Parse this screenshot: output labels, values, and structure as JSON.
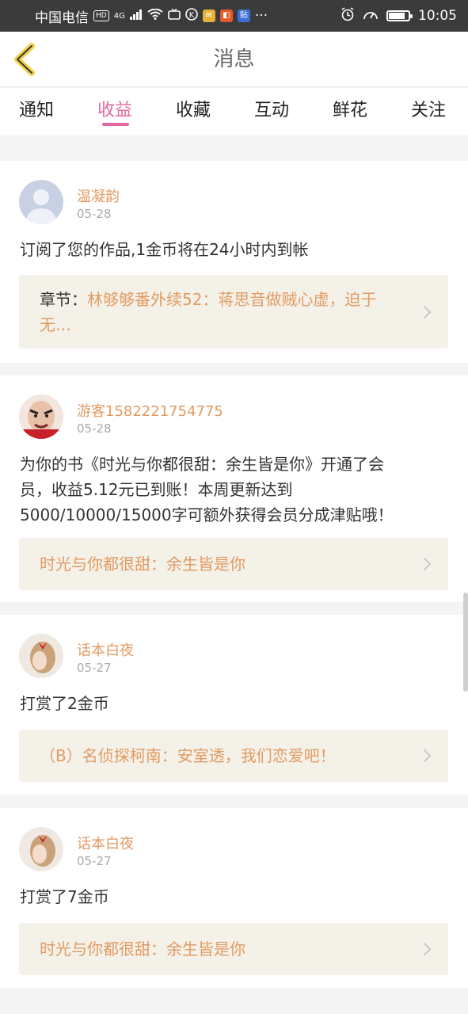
{
  "status_bar": {
    "carrier": "中国电信",
    "hd_badge": "HD",
    "network": "4G",
    "more": "···",
    "time": "10:05",
    "battery_level": 0.85
  },
  "header": {
    "title": "消息",
    "back_icon": "chevron-left-icon"
  },
  "tabs": [
    {
      "label": "通知",
      "active": false
    },
    {
      "label": "收益",
      "active": true
    },
    {
      "label": "收藏",
      "active": false
    },
    {
      "label": "互动",
      "active": false
    },
    {
      "label": "鲜花",
      "active": false
    },
    {
      "label": "关注",
      "active": false
    }
  ],
  "messages": [
    {
      "name": "温凝韵",
      "date": "05-28",
      "text": "订阅了您的作品,1金币将在24小时内到帐",
      "ref_label": "章节：",
      "ref_text": "林够够番外续52：蒋思音做贼心虚，迫于无…"
    },
    {
      "name": "游客1582221754775",
      "date": "05-28",
      "text": "为你的书《时光与你都很甜：余生皆是你》开通了会员，收益5.12元已到账！本周更新达到5000/10000/15000字可额外获得会员分成津贴哦！",
      "ref_label": "",
      "ref_text": "时光与你都很甜：余生皆是你"
    },
    {
      "name": "话本白夜",
      "date": "05-27",
      "text": "打赏了2金币",
      "ref_label": "",
      "ref_text": "（B）名侦探柯南：安室透，我们恋爱吧！"
    },
    {
      "name": "话本白夜",
      "date": "05-27",
      "text": "打赏了7金币",
      "ref_label": "",
      "ref_text": "时光与你都很甜：余生皆是你"
    }
  ],
  "colors": {
    "accent_pink": "#e26aa0",
    "name_orange": "#e29a63",
    "ref_background": "#f4f2e8",
    "back_icon_yellow": "#f2d24b"
  }
}
